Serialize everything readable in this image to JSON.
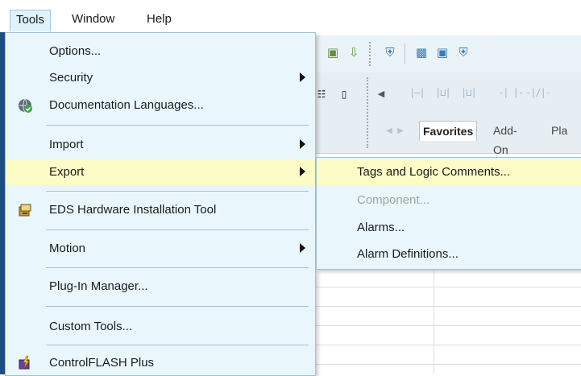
{
  "menubar": {
    "items": [
      "Tools",
      "Window",
      "Help"
    ]
  },
  "tools_menu": {
    "options": "Options...",
    "security": "Security",
    "documentation_languages": "Documentation Languages...",
    "import": "Import",
    "export": "Export",
    "eds_tool": "EDS Hardware Installation Tool",
    "motion": "Motion",
    "plugin_manager": "Plug-In Manager...",
    "custom_tools": "Custom Tools...",
    "controlflash": "ControlFLASH Plus"
  },
  "export_menu": {
    "tags_logic": "Tags and Logic Comments...",
    "component": "Component...",
    "alarms": "Alarms...",
    "alarm_definitions": "Alarm Definitions..."
  },
  "palette_tabs": [
    "Favorites",
    "Add-On",
    "Pla"
  ],
  "colors": {
    "menu_bg": "#e9f7fd",
    "hover": "#fdfbc6",
    "border": "#9dc0d3"
  }
}
